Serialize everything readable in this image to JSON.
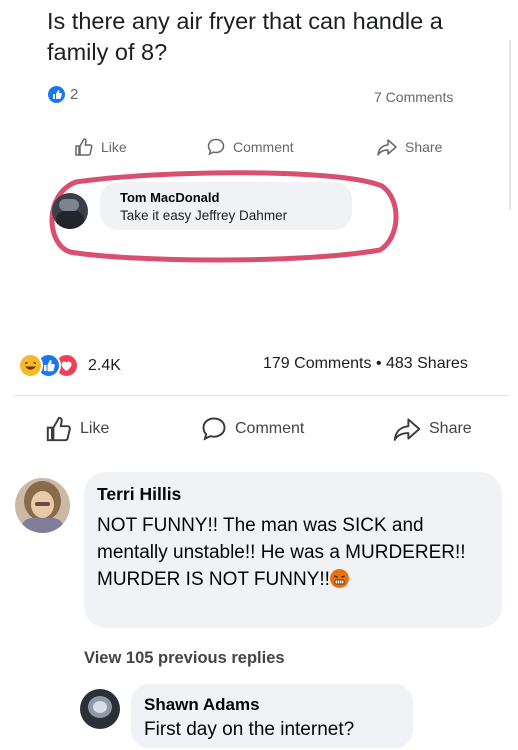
{
  "post1": {
    "title": "Is there any air fryer that can handle a family of 8?",
    "like_count": "2",
    "comments_count": "7 Comments",
    "actions": {
      "like": "Like",
      "comment": "Comment",
      "share": "Share"
    },
    "comment": {
      "name": "Tom MacDonald",
      "text": "Take it easy Jeffrey Dahmer"
    },
    "highlight_color": "#d9506f"
  },
  "post2": {
    "reaction_count": "2.4K",
    "stats": "179 Comments • 483 Shares",
    "actions": {
      "like": "Like",
      "comment": "Comment",
      "share": "Share"
    },
    "comment1": {
      "name": "Terri Hillis",
      "text": "NOT FUNNY!! The man was SICK and mentally unstable!! He was a MURDERER!! MURDER IS NOT FUNNY!!",
      "emoji_icon": "angry-face-icon"
    },
    "view_replies": "View 105 previous replies",
    "comment2": {
      "name": "Shawn Adams",
      "text": "First day on the internet?"
    }
  }
}
